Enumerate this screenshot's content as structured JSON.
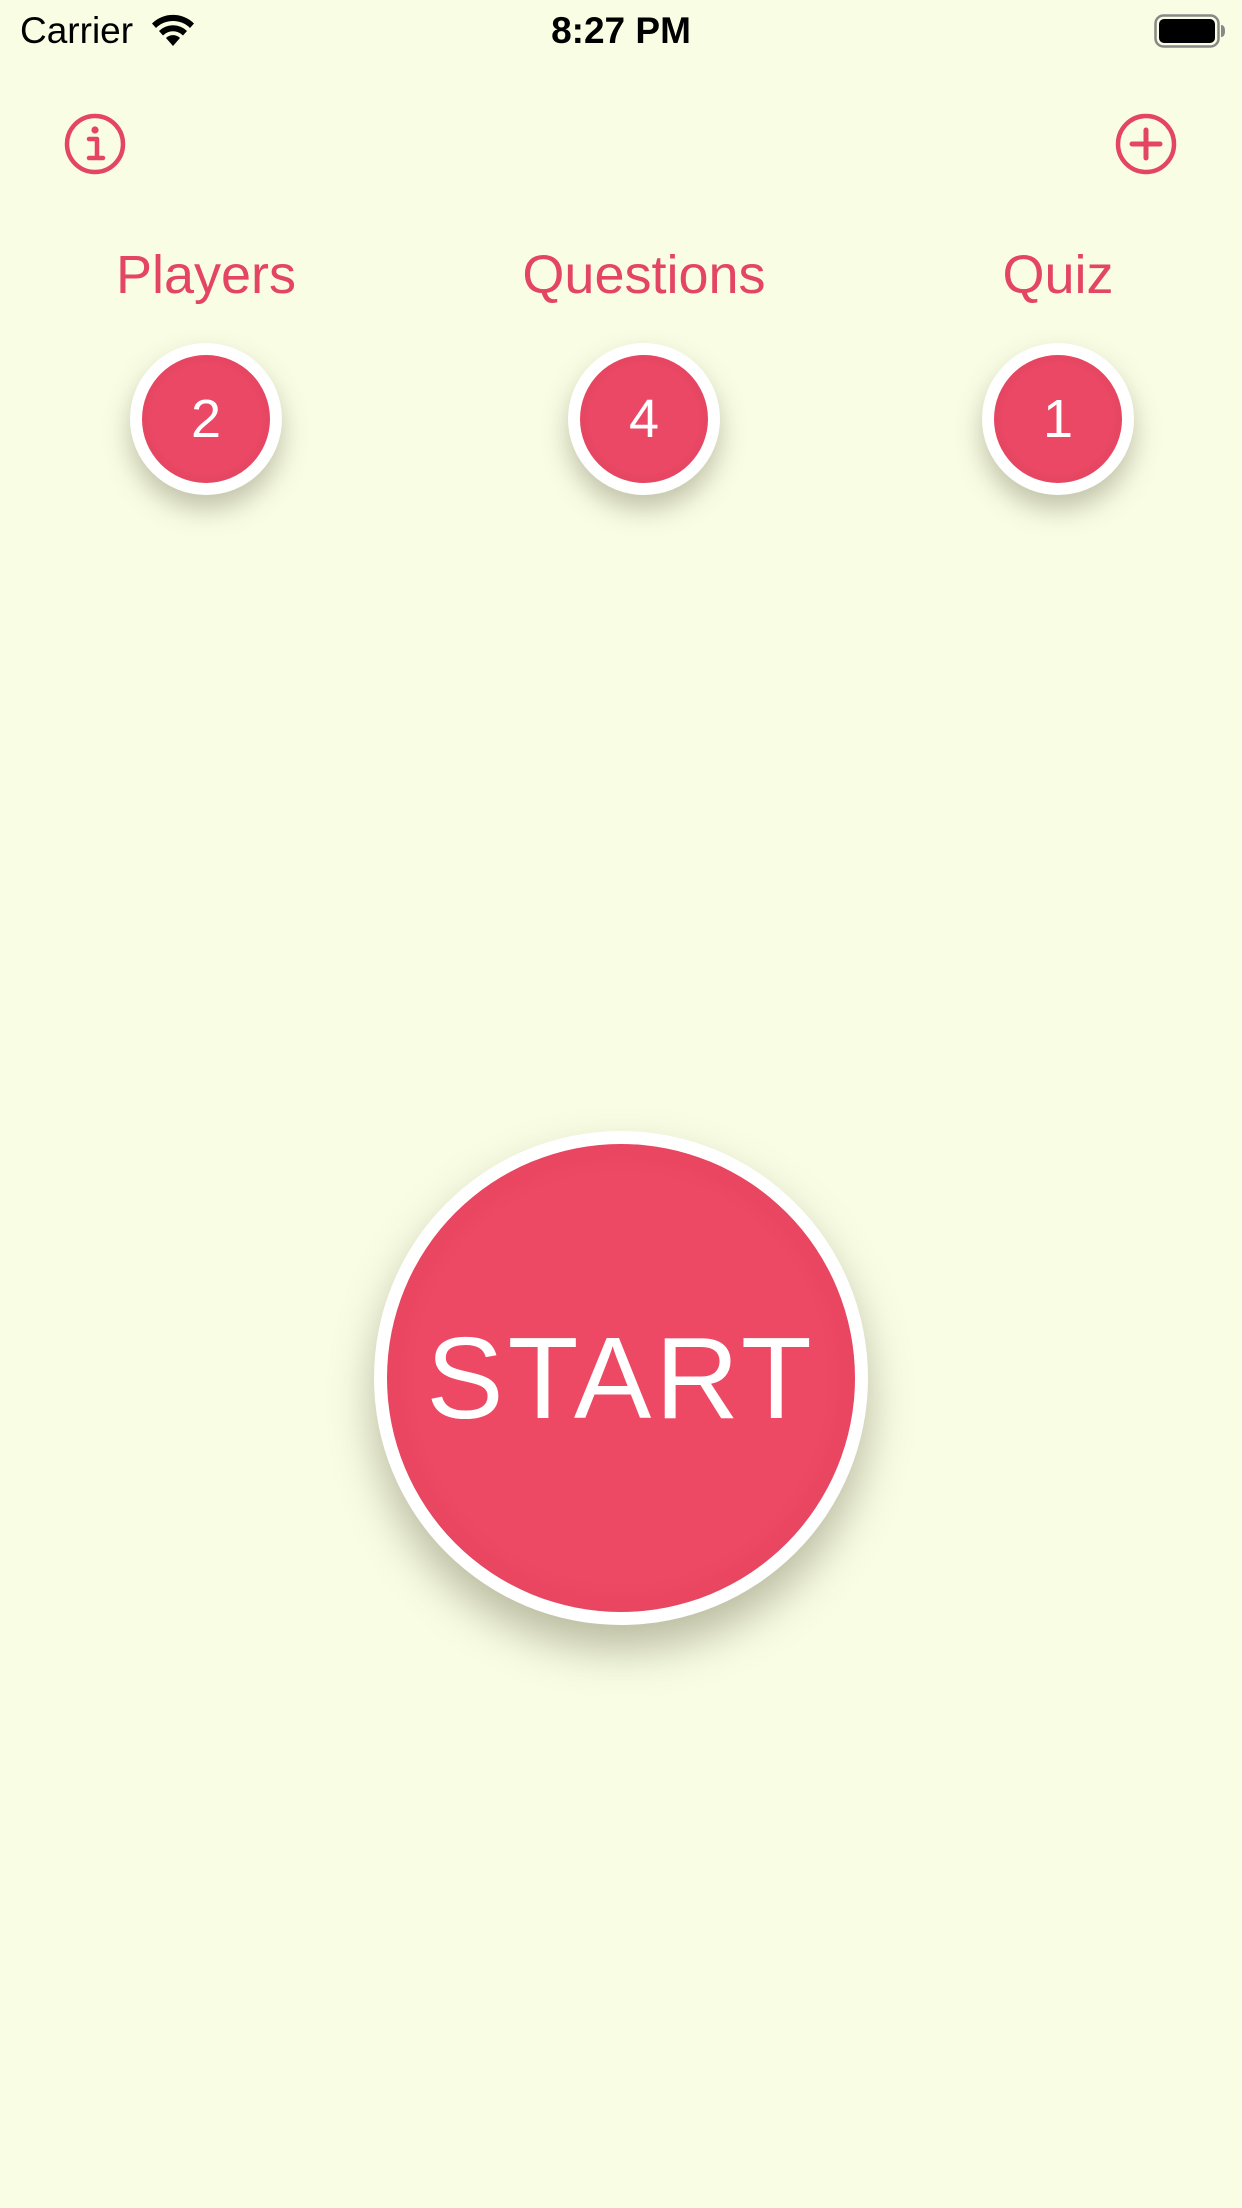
{
  "status_bar": {
    "carrier": "Carrier",
    "time": "8:27 PM"
  },
  "colors": {
    "background": "#F9FDE4",
    "accent": "#E34562",
    "circle_fill": "#EA4864",
    "ring": "#FFFFFF"
  },
  "icons": {
    "info": "info-circle-icon",
    "add": "plus-circle-icon",
    "wifi": "wifi-icon",
    "battery": "battery-icon"
  },
  "counters": [
    {
      "label": "Players",
      "value": "2"
    },
    {
      "label": "Questions",
      "value": "4"
    },
    {
      "label": "Quiz",
      "value": "1"
    }
  ],
  "start_button": {
    "label": "START"
  }
}
